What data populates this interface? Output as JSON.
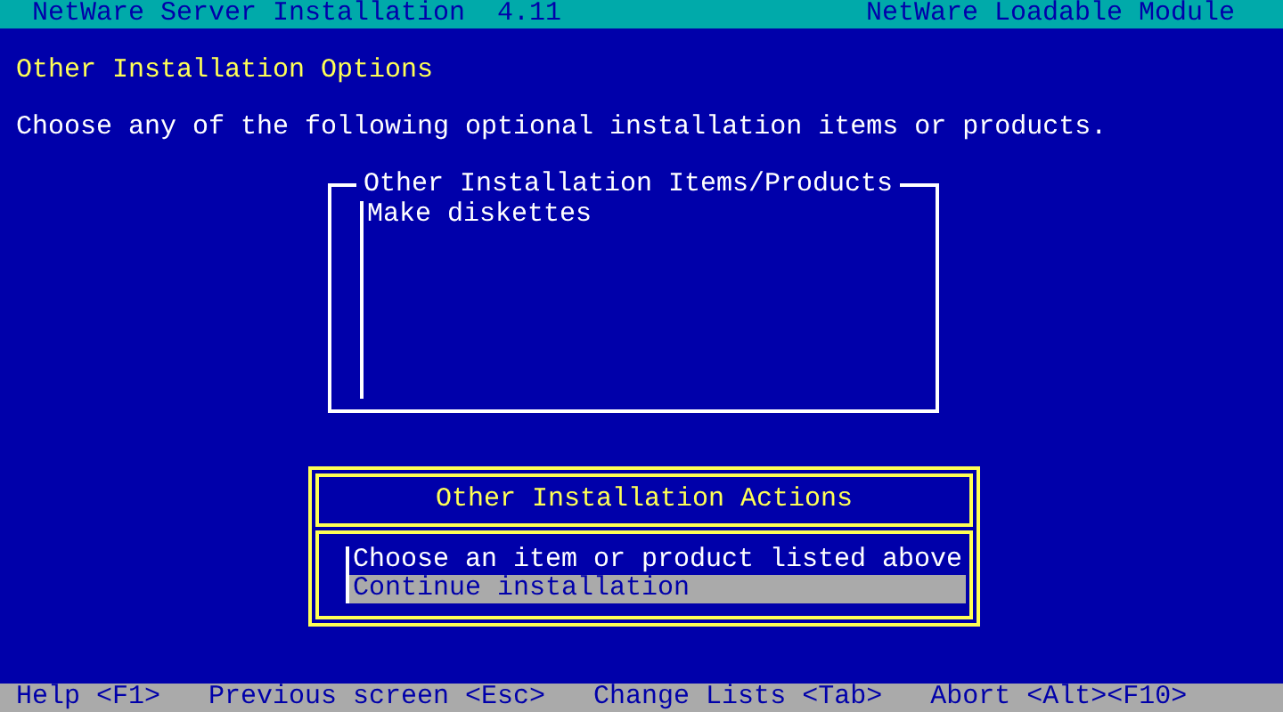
{
  "title_bar": {
    "left": "NetWare Server Installation  4.11",
    "right": "NetWare Loadable Module"
  },
  "heading": "Other Installation Options",
  "description": "Choose any of the following optional installation items or products.",
  "items_list": {
    "title": "Other Installation Items/Products",
    "items": [
      {
        "label": "Make diskettes"
      }
    ]
  },
  "actions_menu": {
    "title": "Other Installation Actions",
    "items": [
      {
        "label": "Choose an item or product listed above",
        "selected": false
      },
      {
        "label": "Continue installation",
        "selected": true
      }
    ]
  },
  "status_bar": [
    "Help <F1>",
    "Previous screen <Esc>",
    "Change Lists <Tab>",
    "Abort <Alt><F10>"
  ]
}
